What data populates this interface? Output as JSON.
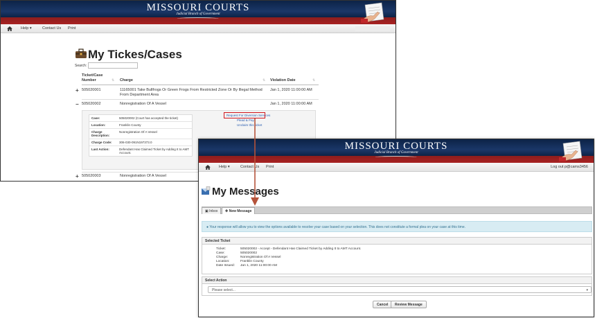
{
  "banner": {
    "title": "MISSOURI COURTS",
    "subtitle": "Judicial Branch of Government"
  },
  "nav": {
    "help": "Help ▾",
    "contact": "Contact Us",
    "print": "Print",
    "logout": "Log out p@cams3456"
  },
  "cases_page": {
    "title": "My Tickes/Cases",
    "search_label": "Search:",
    "search_value": "",
    "columns": {
      "number": "Ticket/Case\nNumber",
      "charge": "Charge",
      "date": "Violation Date"
    },
    "rows": [
      {
        "toggle": "+",
        "number": "505020001",
        "charge": "11165001 Take Bullfrogs Or Green Frogs From Restricted Zone Or By Illegal Method From Department Area",
        "date": "Jan 1, 2020 11:00:00 AM"
      },
      {
        "toggle": "−",
        "number": "505020002",
        "charge": "Nonregistration Of A Vessel",
        "date": "Jan 1, 2020 11:00:00 AM"
      },
      {
        "toggle": "+",
        "number": "505020003",
        "charge": "Nonregistration Of A Vessel",
        "date": ""
      }
    ],
    "detail": {
      "case_label": "Case:",
      "case_value": "505020002 (Court has accepted the ticket)",
      "location_label": "Location:",
      "location_value": "Franklin County",
      "charge_label": "Charge Description:",
      "charge_value": "Nonregistration Of A Vessel",
      "code_label": "Charge Code:",
      "code_value": "306-030-091N197373.0",
      "last_label": "Last Action:",
      "last_value": "Defendant Has Claimed Ticket by Adding It to AMT Account.",
      "link_diversion": "Request For Diversion Services",
      "link_plead": "Plead & Pay",
      "link_unclaim": "Unclaim this ticket"
    }
  },
  "messages_page": {
    "title": "My Messages",
    "tab_inbox": "Inbox",
    "tab_new": "New Message",
    "tab_inbox_icon": "inbox-icon",
    "tab_new_icon": "plus-icon",
    "info_text": "Your response will allow you to view the options available to resolve your case based on your selection. This does not constitute a formal plea on your case at this time.",
    "selected_ticket_header": "Selected Ticket",
    "ticket_label": "Ticket:",
    "ticket_value": "505020002 - Accept - Defendant Has Claimed Ticket by Adding It to AMT Account.",
    "case_label": "Case:",
    "case_value": "505020002",
    "charge_label": "Charge:",
    "charge_value": "Nonregistration Of A Vessel",
    "location_label": "Location:",
    "location_value": "Franklin County",
    "date_label": "Date Issued:",
    "date_value": "Jan 1, 2020 11:00:00 AM",
    "select_action_header": "Select Action",
    "select_value": "Please select...",
    "cancel": "Cancel",
    "review": "Review Message"
  },
  "colors": {
    "banner_navy": "#0c2347",
    "banner_red": "#a82222",
    "highlight": "#d0141c",
    "arrow": "#b5533a",
    "link": "#2a5db0",
    "info_bg": "#d8ecf3"
  }
}
